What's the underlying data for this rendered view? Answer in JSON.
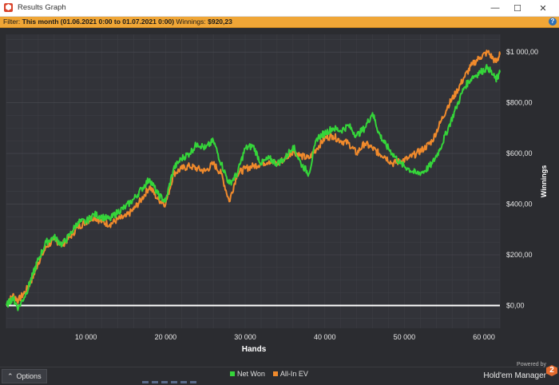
{
  "window": {
    "title": "Results Graph",
    "minimize": "—",
    "maximize": "☐",
    "close": "✕"
  },
  "filter": {
    "prefix": "Filter:",
    "period": "This month (01.06.2021 0:00 to 01.07.2021 0:00)",
    "winnings_label": "Winnings:",
    "winnings_value": "$920,23",
    "help": "?"
  },
  "footer": {
    "options_icon": "chevron-up-icon",
    "options_label": "Options",
    "powered_by": "Powered by",
    "brand": "Hold'em Manager",
    "brand_badge": "2"
  },
  "chart_data": {
    "type": "line",
    "xlabel": "Hands",
    "ylabel": "Winnings",
    "xlim": [
      0,
      62000
    ],
    "ylim": [
      -90,
      1070
    ],
    "x_ticks": [
      10000,
      20000,
      30000,
      40000,
      50000,
      60000
    ],
    "x_tick_labels": [
      "10 000",
      "20 000",
      "30 000",
      "40 000",
      "50 000",
      "60 000"
    ],
    "y_ticks": [
      0,
      200,
      400,
      600,
      800,
      1000
    ],
    "y_tick_labels": [
      "$0,00",
      "$200,00",
      "$400,00",
      "$600,00",
      "$800,00",
      "$1 000,00"
    ],
    "grid": true,
    "legend_position": "bottom",
    "series": [
      {
        "name": "Net Won",
        "color": "#35d53a",
        "x": [
          0,
          800,
          1500,
          2500,
          3300,
          4000,
          5000,
          6000,
          7000,
          8000,
          9000,
          10000,
          11000,
          12000,
          13000,
          14000,
          15000,
          16000,
          17000,
          18000,
          19000,
          20000,
          21000,
          22000,
          23000,
          24000,
          25000,
          26000,
          27000,
          28000,
          29000,
          30000,
          31000,
          32000,
          33000,
          34000,
          35000,
          36000,
          37000,
          38000,
          39000,
          40000,
          41000,
          42000,
          43000,
          44000,
          45000,
          46000,
          46800,
          47500,
          48500,
          49500,
          50500,
          51500,
          52500,
          53500,
          54500,
          55500,
          56500,
          57500,
          58500,
          59500,
          60500,
          61500,
          62000
        ],
        "y": [
          0,
          30,
          -10,
          50,
          120,
          180,
          250,
          270,
          240,
          280,
          330,
          330,
          360,
          350,
          340,
          370,
          390,
          420,
          460,
          500,
          440,
          410,
          540,
          580,
          600,
          640,
          620,
          650,
          560,
          480,
          520,
          620,
          630,
          560,
          580,
          560,
          580,
          630,
          560,
          520,
          660,
          680,
          700,
          690,
          710,
          670,
          700,
          760,
          680,
          640,
          600,
          560,
          540,
          520,
          530,
          560,
          620,
          700,
          780,
          860,
          900,
          920,
          940,
          890,
          920
        ]
      },
      {
        "name": "All-In EV",
        "color": "#f08a2c",
        "x": [
          0,
          800,
          1500,
          2500,
          3300,
          4000,
          5000,
          6000,
          7000,
          8000,
          9000,
          10000,
          11000,
          12000,
          13000,
          14000,
          15000,
          16000,
          17000,
          18000,
          19000,
          20000,
          21000,
          22000,
          23000,
          24000,
          25000,
          26000,
          27000,
          28000,
          29000,
          30000,
          31000,
          32000,
          33000,
          34000,
          35000,
          36000,
          37000,
          38000,
          39000,
          40000,
          41000,
          42000,
          43000,
          44000,
          45000,
          46000,
          46800,
          47500,
          48500,
          49500,
          50500,
          51500,
          52500,
          53500,
          54500,
          55500,
          56500,
          57500,
          58500,
          59500,
          60500,
          61500,
          62000
        ],
        "y": [
          0,
          40,
          20,
          60,
          110,
          170,
          230,
          260,
          240,
          270,
          310,
          330,
          350,
          330,
          320,
          340,
          350,
          380,
          420,
          470,
          420,
          400,
          520,
          540,
          550,
          540,
          530,
          560,
          520,
          410,
          520,
          540,
          550,
          560,
          570,
          560,
          580,
          610,
          590,
          580,
          620,
          660,
          670,
          650,
          640,
          600,
          640,
          620,
          600,
          590,
          560,
          570,
          580,
          600,
          620,
          650,
          720,
          790,
          840,
          900,
          950,
          980,
          1000,
          960,
          990
        ]
      }
    ]
  }
}
